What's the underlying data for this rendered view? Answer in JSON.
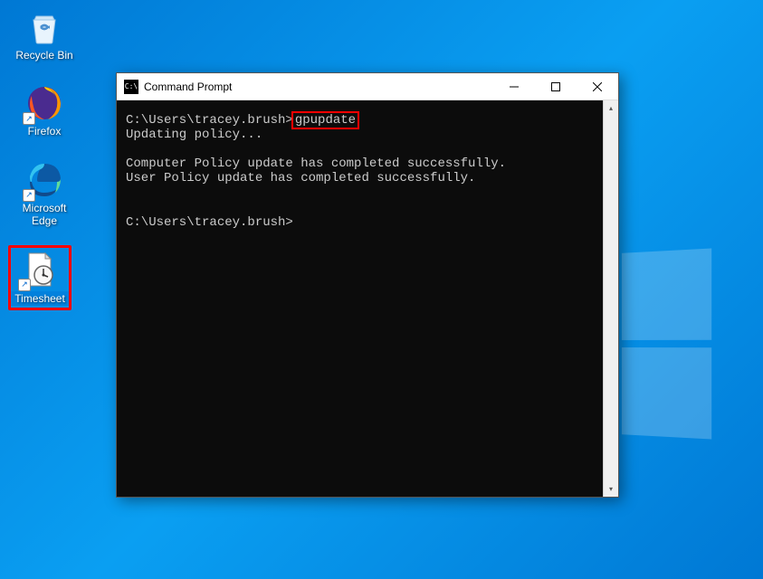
{
  "desktop": {
    "icons": [
      {
        "label": "Recycle Bin",
        "iconName": "recycle-bin"
      },
      {
        "label": "Firefox",
        "iconName": "firefox"
      },
      {
        "label": "Microsoft Edge",
        "iconName": "edge"
      },
      {
        "label": "Timesheet",
        "iconName": "timesheet",
        "highlighted": true
      }
    ]
  },
  "cmdWindow": {
    "title": "Command Prompt",
    "content": {
      "prompt1_path": "C:\\Users\\tracey.brush>",
      "prompt1_cmd": "gpupdate",
      "line2": "Updating policy...",
      "line3": "",
      "line4": "Computer Policy update has completed successfully.",
      "line5": "User Policy update has completed successfully.",
      "line6": "",
      "line7": "",
      "prompt2": "C:\\Users\\tracey.brush>"
    },
    "controls": {
      "minimize": "—",
      "maximize": "☐",
      "close": "✕"
    }
  }
}
